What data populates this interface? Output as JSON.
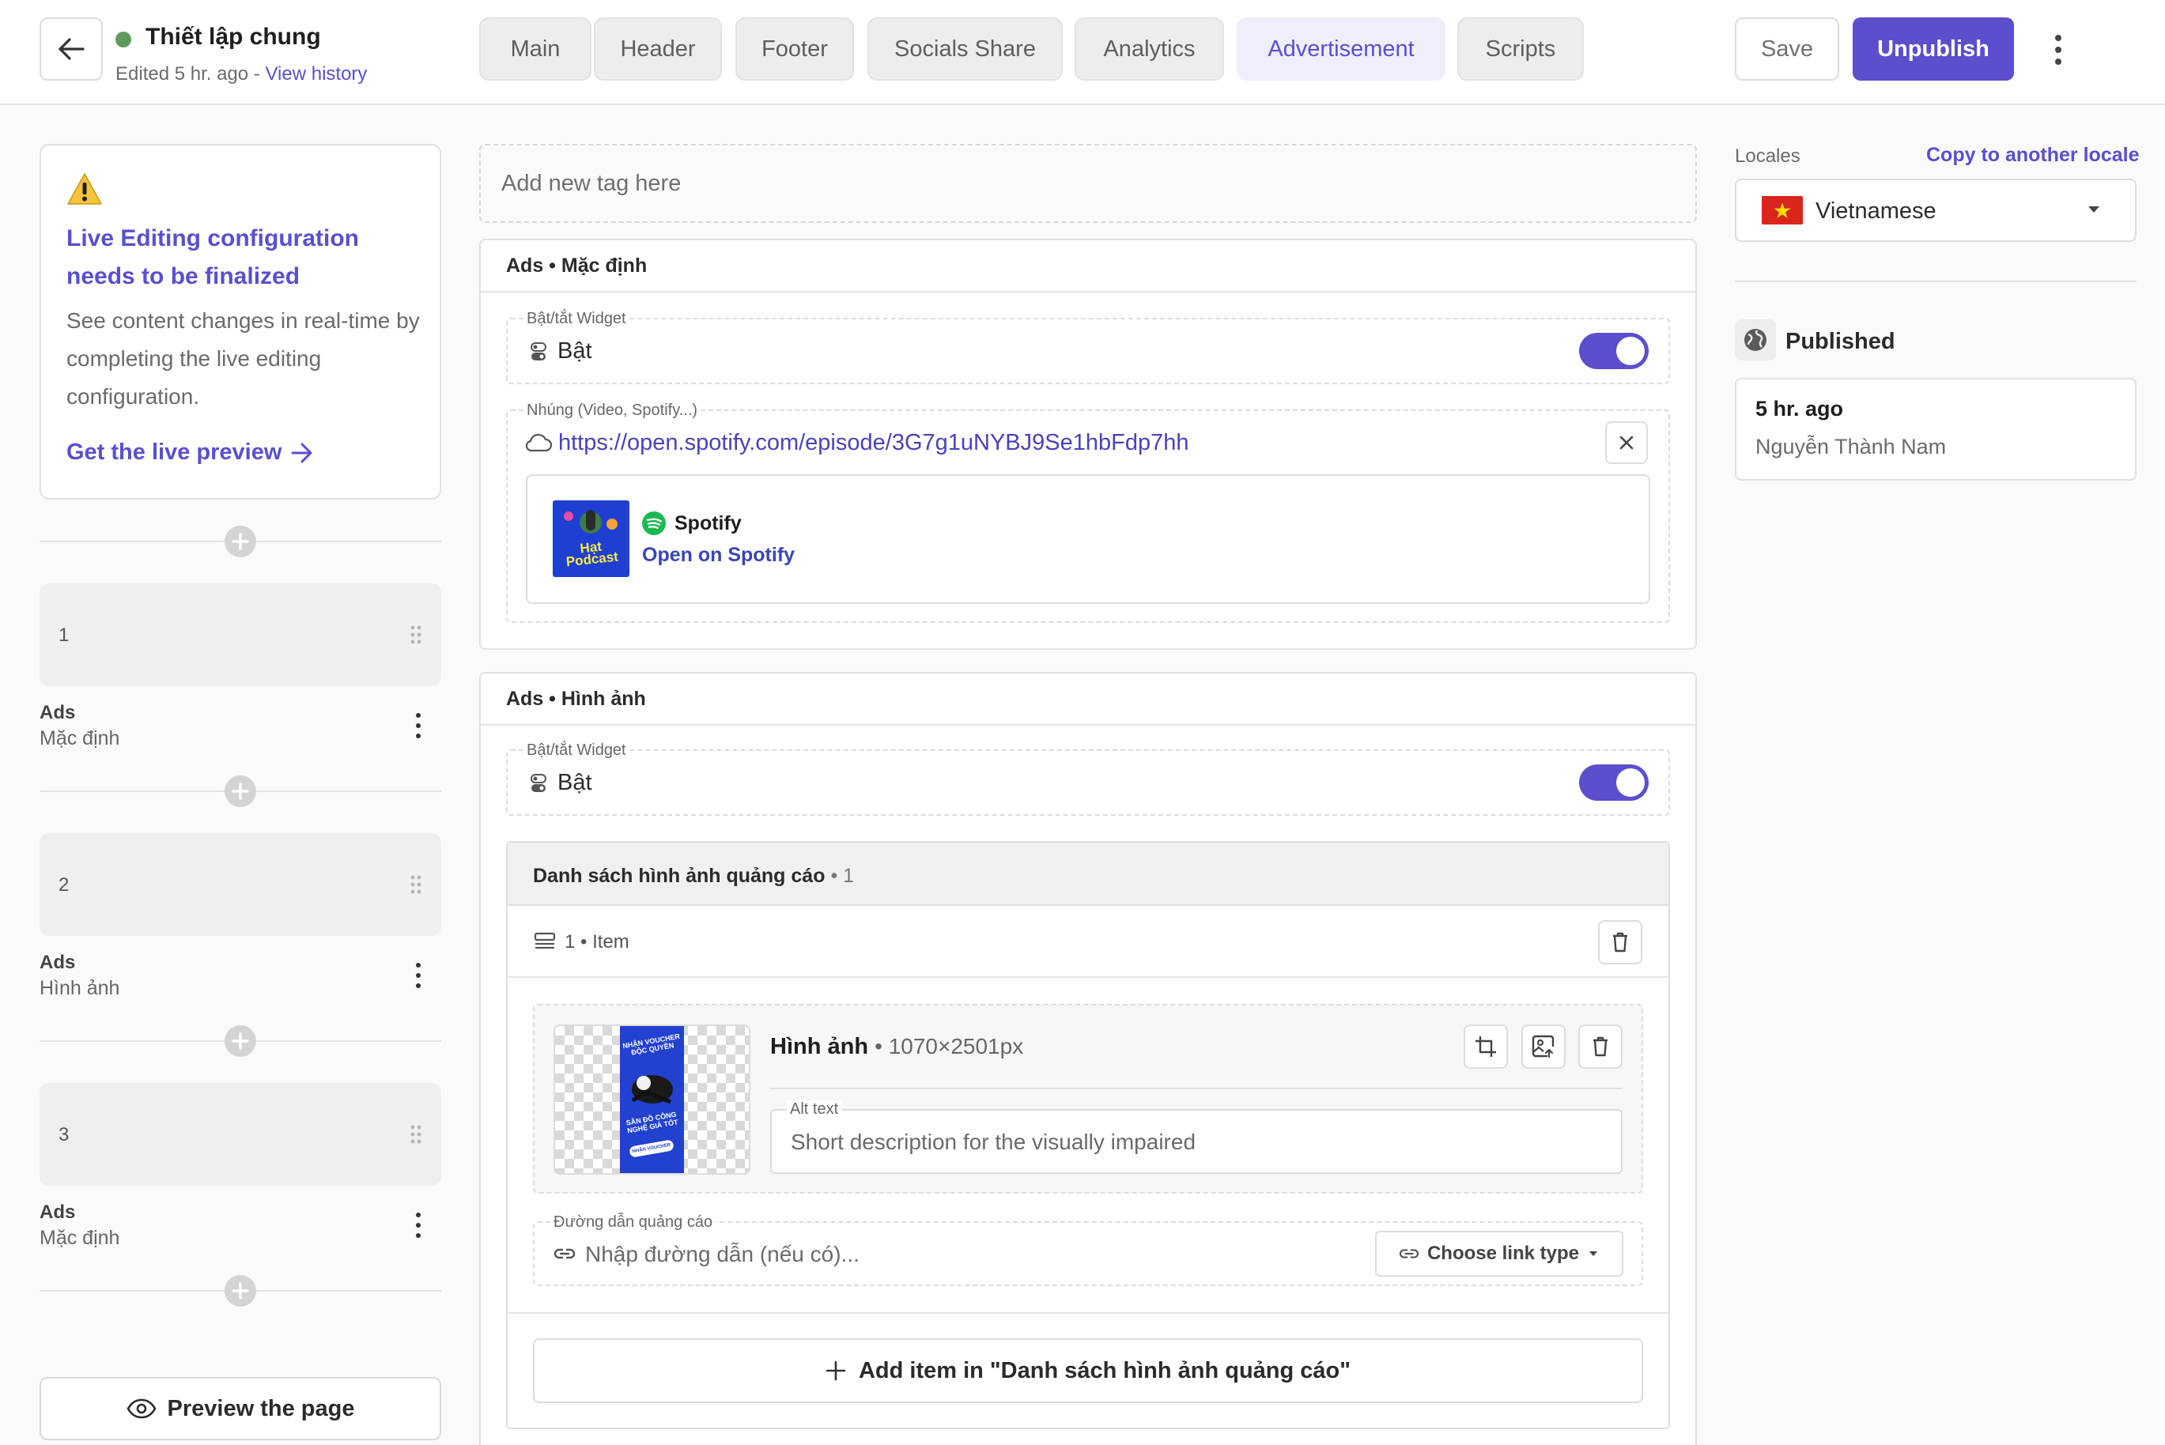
{
  "header": {
    "page_name": "Thiết lập chung",
    "edited_text": "Edited 5 hr. ago - ",
    "view_history": "View history",
    "tabs": [
      {
        "label": "Main"
      },
      {
        "label": "Header"
      },
      {
        "label": "Footer"
      },
      {
        "label": "Socials Share"
      },
      {
        "label": "Analytics"
      },
      {
        "label": "Advertisement",
        "active": true
      },
      {
        "label": "Scripts"
      }
    ],
    "save_label": "Save",
    "unpublish_label": "Unpublish"
  },
  "sidebar": {
    "live_title": "Live Editing configuration needs to be finalized",
    "live_desc": "See content changes in real-time by completing the live editing configuration.",
    "live_link": "Get the live preview",
    "blocks": [
      {
        "num": "1",
        "type": "Ads",
        "sub": "Mặc định"
      },
      {
        "num": "2",
        "type": "Ads",
        "sub": "Hình ảnh"
      },
      {
        "num": "3",
        "type": "Ads",
        "sub": "Mặc định"
      }
    ],
    "preview_label": "Preview the page"
  },
  "main": {
    "tag_placeholder": "Add new tag here",
    "panel1": {
      "title": "Ads • Mặc định",
      "toggle_label": "Bật/tắt Widget",
      "toggle_value": "Bật",
      "embed_label": "Nhúng (Video, Spotify...)",
      "embed_url": "https://open.spotify.com/episode/3G7g1uNYBJ9Se1hbFdp7hh",
      "spotify_name": "Spotify",
      "spotify_link": "Open on Spotify",
      "thumb_text_1": "Hạt",
      "thumb_text_2": "Podcast"
    },
    "panel2": {
      "title": "Ads • Hình ảnh",
      "toggle_label": "Bật/tắt Widget",
      "toggle_value": "Bật",
      "list_title": "Danh sách hình ảnh quảng cáo",
      "list_count": "• 1",
      "item_label": "1 • Item",
      "image_label": "Hình ảnh",
      "image_size": "• 1070×2501px",
      "alt_label": "Alt text",
      "alt_placeholder": "Short description for the visually impaired",
      "link_label": "Đường dẫn quảng cáo",
      "link_placeholder": "Nhập đường dẫn (nếu có)...",
      "link_type": "Choose link type",
      "add_item": "Add item in \"Danh sách hình ảnh quảng cáo\"",
      "poster_text_1": "NHẬN VOUCHER ĐỘC QUYỀN",
      "poster_text_2": "SĂN ĐỒ CÔNG NGHỆ GIÁ TỐT",
      "poster_text_3": "NHẬN VOUCHER"
    }
  },
  "right": {
    "locales_label": "Locales",
    "copy_link": "Copy to another locale",
    "locale_value": "Vietnamese",
    "published_label": "Published",
    "pub_time": "5 hr. ago",
    "pub_user": "Nguyễn Thành Nam"
  },
  "colors": {
    "accent": "#5b4fcb",
    "status_dot": "#5e9a5a",
    "spotify_green": "#1db954",
    "flag_red": "#da251d",
    "flag_star": "#ffde00"
  }
}
